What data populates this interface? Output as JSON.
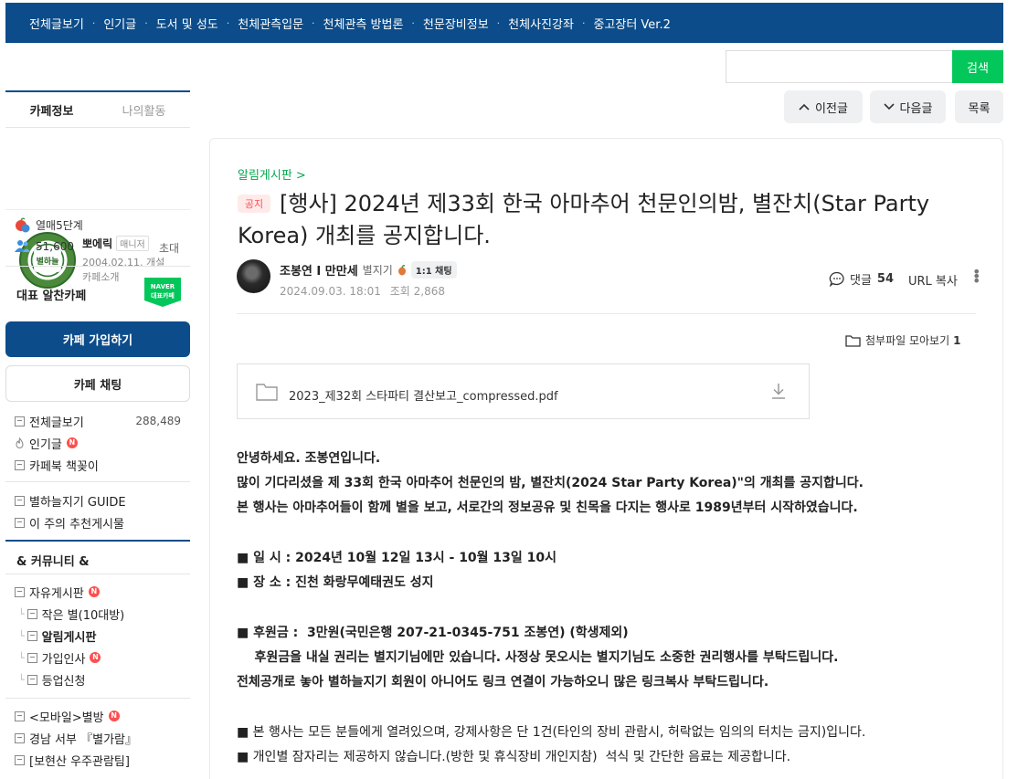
{
  "topnav": [
    "전체글보기",
    "인기글",
    "도서 및 성도",
    "천체관측입문",
    "천체관측 방법론",
    "천문장비정보",
    "천체사진강좌",
    "중고장터 Ver.2"
  ],
  "topnav_sep": "·",
  "search": {
    "button": "검색",
    "placeholder": ""
  },
  "nav_buttons": {
    "prev": "이전글",
    "next": "다음글",
    "list": "목록"
  },
  "sidebar": {
    "tabs": [
      "카페정보",
      "나의활동"
    ],
    "manager": {
      "name": "뽀에릭",
      "role": "매니저",
      "date": "2004.02.11. 개설",
      "intro": "카페소개",
      "logo_text": "별하늘"
    },
    "level": "열매5단계",
    "members": "51,600",
    "invite": "초대",
    "representative": "대표 알찬카페",
    "naver_badge": [
      "NAVER",
      "대표카페"
    ],
    "join_button": "카페 가입하기",
    "chat_button": "카페 채팅",
    "menu1": [
      {
        "label": "전체글보기",
        "count": "288,489"
      },
      {
        "label": "인기글",
        "new": "N"
      },
      {
        "label": "카페북 책꽂이"
      }
    ],
    "menu2": [
      {
        "label": "별하늘지기 GUIDE"
      },
      {
        "label": "이 주의 추천게시물"
      }
    ],
    "community_title": "& 커뮤니티 &",
    "menu3": [
      {
        "label": "자유게시판",
        "new": "N"
      },
      {
        "label": "작은 별(10대방)"
      },
      {
        "label": "알림게시판"
      },
      {
        "label": "가입인사",
        "new": "N"
      },
      {
        "label": "등업신청"
      }
    ],
    "menu4": [
      {
        "label": "<모바일>별방",
        "new": "N"
      },
      {
        "label": "경남 서부 『별가람』"
      },
      {
        "label": "[보현산 우주관람팀]"
      }
    ]
  },
  "article": {
    "board": "알림게시판 >",
    "badge": "공지",
    "title": "[행사] 2024년 제33회 한국 아마추어 천문인의밤, 별잔치(Star Party Korea) 개최를 공지합니다.",
    "author": "조봉연 I 만만세",
    "grade": "별지기",
    "chat": "1:1 채팅",
    "date": "2024.09.03. 18:01",
    "views_label": "조회 2,868",
    "comments_label": "댓글",
    "comments": "54",
    "url_copy": "URL 복사",
    "attach_all": "첨부파일 모아보기",
    "attach_count": "1",
    "file_name": "2023_제32회 스타파티 결산보고_compressed.pdf",
    "body": {
      "l1": "안녕하세요. 조봉연입니다.",
      "l2": "많이 기다리셨을 제 33회 한국 아마추어 천문인의 밤, 별잔치(2024 Star Party Korea)\"의 개최를 공지합니다.",
      "l3": "본 행사는 아마추어들이 함께 별을 보고, 서로간의 정보공유 및 친목을 다지는 행사로 1989년부터 시작하였습니다.",
      "l4": "■ 일  시 : 2024년 10월 12일 13시 - 10월 13일 10시",
      "l5": "■ 장  소 : 진천 화랑무예태권도 성지",
      "l6": "■ 후원금 :  3만원(국민은행 207-21-0345-751 조봉연) (학생제외)",
      "l7": "    후원금을 내실 권리는 별지기님에만 있습니다. 사정상 못오시는 별지기님도 소중한 권리행사를 부탁드립니다.",
      "l8": "전체공개로 놓아 별하늘지기 회원이 아니어도 링크 연결이 가능하오니 많은 링크복사 부탁드립니다.",
      "l9": "■ 본 행사는 모든 분들에게 열려있으며, 강제사항은 단 1건(타인의 장비 관람시, 허락없는 임의의 터치는 금지)입니다.",
      "l10": "■ 개인별 잠자리는 제공하지 않습니다.(방한 및 휴식장비 개인지참)  석식 및 간단한 음료는 제공합니다."
    }
  }
}
